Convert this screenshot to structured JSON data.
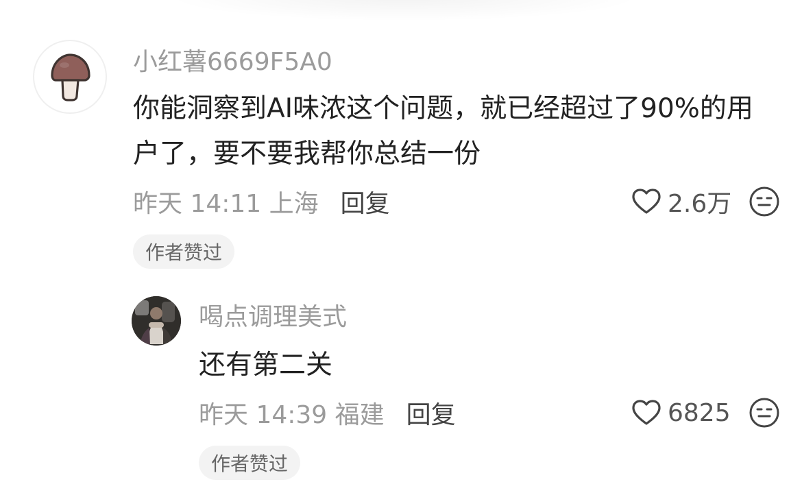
{
  "comments": [
    {
      "username": "小红薯6669F5A0",
      "content": "你能洞察到AI味浓这个问题，就已经超过了90%的用户了，要不要我帮你总结一份",
      "time": "昨天 14:11",
      "location": "上海",
      "reply_label": "回复",
      "like_count": "2.6万",
      "badge": "作者赞过",
      "avatar_icon": "mushroom-avatar-icon",
      "reaction_icon": "neutral-face-icon",
      "like_icon": "heart-outline-icon"
    },
    {
      "username": "喝点调理美式",
      "content": "还有第二关",
      "time": "昨天 14:39",
      "location": "福建",
      "reply_label": "回复",
      "like_count": "6825",
      "badge": "作者赞过",
      "avatar_icon": "photo-avatar-icon",
      "reaction_icon": "neutral-face-icon",
      "like_icon": "heart-outline-icon"
    }
  ],
  "colors": {
    "background": "#ffffff",
    "username": "#9b9b9b",
    "content": "#222222",
    "meta": "#9b9b9b",
    "reply": "#444444",
    "badge_background": "#f3f3f3",
    "badge_text": "#666666",
    "icon": "#444444",
    "mushroom_cap": "#8f5f5a",
    "mushroom_stem": "#f2e8e1"
  }
}
